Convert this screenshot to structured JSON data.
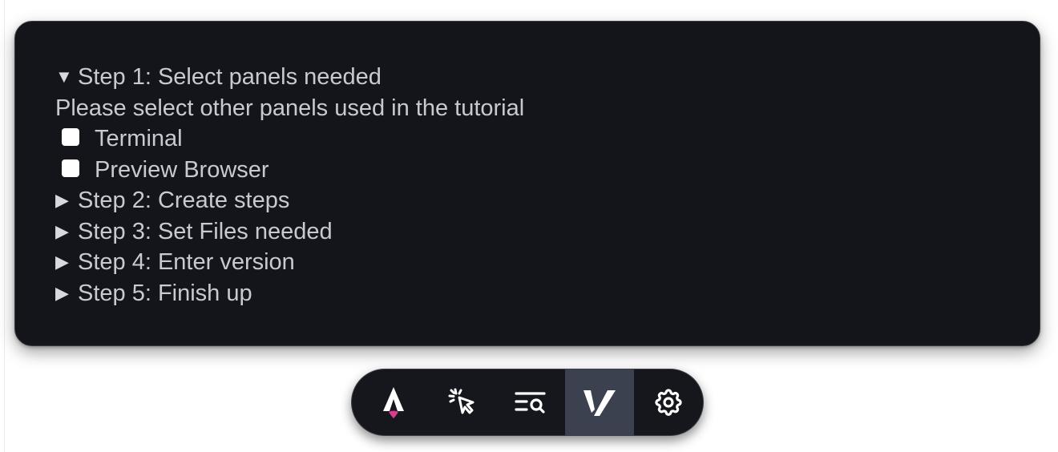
{
  "steps": [
    {
      "label": "Step 1: Select panels needed",
      "expanded": true
    },
    {
      "label": "Step 2: Create steps",
      "expanded": false
    },
    {
      "label": "Step 3: Set Files needed",
      "expanded": false
    },
    {
      "label": "Step 4: Enter version",
      "expanded": false
    },
    {
      "label": "Step 5: Finish up",
      "expanded": false
    }
  ],
  "step1": {
    "description": "Please select other panels used in the tutorial",
    "options": [
      {
        "label": "Terminal",
        "checked": false
      },
      {
        "label": "Preview Browser",
        "checked": false
      }
    ]
  },
  "icons": {
    "expanded": "▼",
    "collapsed": "▶"
  },
  "toolbar": {
    "buttons": [
      {
        "icon": "astro-logo-icon",
        "active": false
      },
      {
        "icon": "cursor-click-icon",
        "active": false
      },
      {
        "icon": "list-search-icon",
        "active": false
      },
      {
        "icon": "v-logo-icon",
        "active": true
      },
      {
        "icon": "gear-icon",
        "active": false
      }
    ]
  },
  "colors": {
    "panel_bg": "#14151a",
    "text": "#c9cad0",
    "toolbar_active": "#3c4150",
    "astro_accent": "#d83b8f"
  }
}
